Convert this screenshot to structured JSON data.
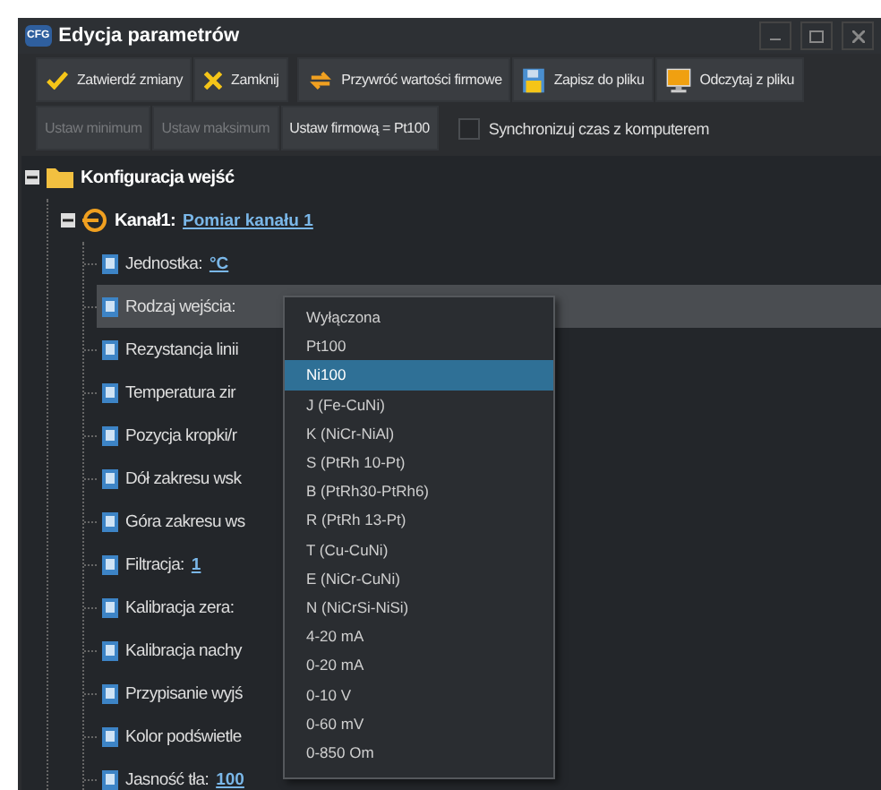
{
  "window": {
    "icon_text": "CFG",
    "title": "Edycja parametrów"
  },
  "toolbar": [
    {
      "label": "Zatwierdź zmiany",
      "kind": "confirm"
    },
    {
      "label": "Zamknij",
      "kind": "close"
    },
    {
      "label": "Przywróć wartości firmowe",
      "kind": "restore"
    },
    {
      "label": "Zapisz do pliku",
      "kind": "save"
    },
    {
      "label": "Odczytaj z pliku",
      "kind": "load"
    }
  ],
  "toolbar2": {
    "buttons": [
      {
        "label": "Ustaw minimum",
        "disabled": true
      },
      {
        "label": "Ustaw maksimum",
        "disabled": true
      },
      {
        "label": "Ustaw firmową = Pt100",
        "disabled": false
      }
    ],
    "checkbox": {
      "label": "Synchronizuj czas z komputerem",
      "checked": false
    }
  },
  "tree": {
    "label": "Konfiguracja wejść",
    "expanded": true,
    "children": [
      {
        "label": "Kanał1:",
        "value": "Pomiar kanału 1",
        "expanded": true,
        "children": [
          {
            "label": "Jednostka:",
            "value": "°C",
            "selected": false
          },
          {
            "label": "Rodzaj wejścia:",
            "selected": true
          },
          {
            "label": "Rezystancja linii",
            "selected": false
          },
          {
            "label": "Temperatura zir",
            "selected": false
          },
          {
            "label": "Pozycja kropki/r",
            "selected": false
          },
          {
            "label": "Dół zakresu wsk",
            "selected": false
          },
          {
            "label": "Góra zakresu ws",
            "selected": false
          },
          {
            "label": "Filtracja:",
            "value": "1",
            "selected": false
          },
          {
            "label": "Kalibracja zera:",
            "selected": false
          },
          {
            "label": "Kalibracja nachy",
            "selected": false
          },
          {
            "label": "Przypisanie wyjś",
            "selected": false
          },
          {
            "label": "Kolor podświetle",
            "selected": false
          },
          {
            "label": "Jasność tła:",
            "value": "100",
            "selected": false
          }
        ]
      }
    ]
  },
  "dropdown": {
    "items": [
      {
        "label": "Wyłączona",
        "selected": false
      },
      {
        "label": "Pt100",
        "selected": false
      },
      {
        "label": "Ni100",
        "selected": true
      },
      {
        "label": "J (Fe-CuNi)",
        "selected": false
      },
      {
        "label": "K (NiCr-NiAl)",
        "selected": false
      },
      {
        "label": "S (PtRh 10-Pt)",
        "selected": false
      },
      {
        "label": "B (PtRh30-PtRh6)",
        "selected": false
      },
      {
        "label": "R (PtRh 13-Pt)",
        "selected": false
      },
      {
        "label": "T (Cu-CuNi)",
        "selected": false
      },
      {
        "label": "E (NiCr-CuNi)",
        "selected": false
      },
      {
        "label": "N (NiCrSi-NiSi)",
        "selected": false
      },
      {
        "label": "4-20 mA",
        "selected": false
      },
      {
        "label": "0-20 mA",
        "selected": false
      },
      {
        "label": "0-10 V",
        "selected": false
      },
      {
        "label": "0-60 mV",
        "selected": false
      },
      {
        "label": "0-850 Om",
        "selected": false
      }
    ]
  }
}
